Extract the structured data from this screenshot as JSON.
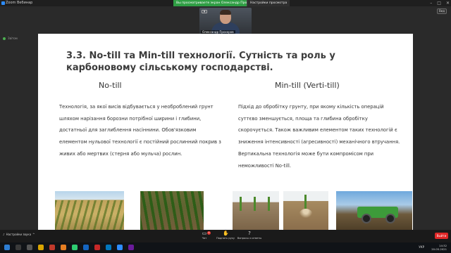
{
  "window": {
    "app_title": "Zoom Вебинар",
    "share_banner": "Вы просматриваете экран Олександр Прохоров",
    "share_options": "Настройки просмотра",
    "view_button": "Вид",
    "status_text": "Звітом"
  },
  "video": {
    "participant_name": "Олександр Прохоров"
  },
  "slide": {
    "title": "3.3. No-till та Min-till технології. Сутність та роль у карбоновому сільському господарстві.",
    "left_heading": "No-till",
    "right_heading": "Min-till (Verti-till)",
    "left_text": "Технологія, за якої висів відбувається у необроблений грунт шляхом нарізання борозни потрібної ширини і глибини, достатньої для заглиблення насіннини. Обов'язковим елементом нульової технології є постійний рослинний покрив з живих або мертвих (стерня або мульча) рослин.",
    "right_text": "Підхід до обробітку грунту, при якому кількість операцій суттєво зменшується, площа та глибина обробітку скорочується. Також важливим елементом таких технологій є зниження інтенсивності (агресивності) механічного втручання. Вертикальна технологія може бути компромісом при неможливості No-till.",
    "images": [
      "wheat-field-photo",
      "no-till-crop-rows-photo",
      "corn-seedlings-soil-photo",
      "corn-roots-soil-photo",
      "green-tillage-machine-photo"
    ]
  },
  "toolbar": {
    "audio_label": "Настройки звука",
    "chat_label": "Чат",
    "chat_badge": "3",
    "raise_hand_label": "Поднять руку",
    "qa_label": "Вопросы и ответы",
    "leave_label": "Выйти"
  },
  "taskbar": {
    "language": "УКР",
    "time": "14:32",
    "date": "20.05.2021"
  },
  "colors": {
    "share_banner": "#2f9e44",
    "leave_button": "#e02828",
    "slide_background": "#ffffff",
    "zoom_blue": "#2d8cff"
  }
}
